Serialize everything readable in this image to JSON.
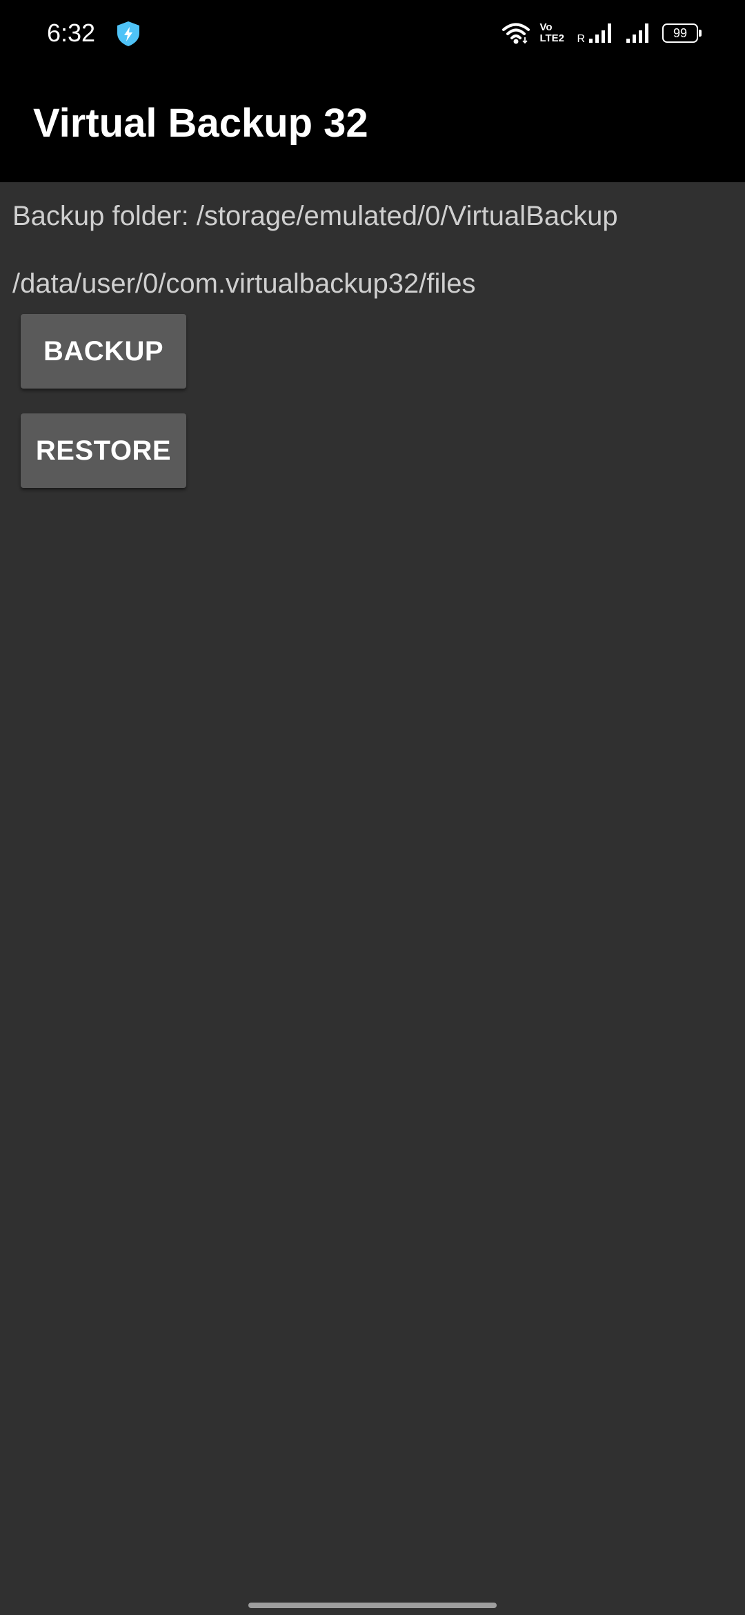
{
  "status_bar": {
    "time": "6:32",
    "icons": [
      "shield-bolt-icon",
      "wifi-icon",
      "volte-icon",
      "signal-icon",
      "signal-icon"
    ],
    "volte_line1": "Vo",
    "volte_line2": "LTE2",
    "roaming": "R",
    "battery": "99",
    "accent_color": "#4fc3f7"
  },
  "app_bar": {
    "title": "Virtual Backup 32",
    "background": "#000000"
  },
  "main": {
    "backup_folder": "Backup folder: /storage/emulated/0/VirtualBackup",
    "files_path": "/data/user/0/com.virtualbackup32/files",
    "backup_label": "BACKUP",
    "restore_label": "RESTORE",
    "background": "#303030",
    "button_color": "#5a5a5a"
  }
}
